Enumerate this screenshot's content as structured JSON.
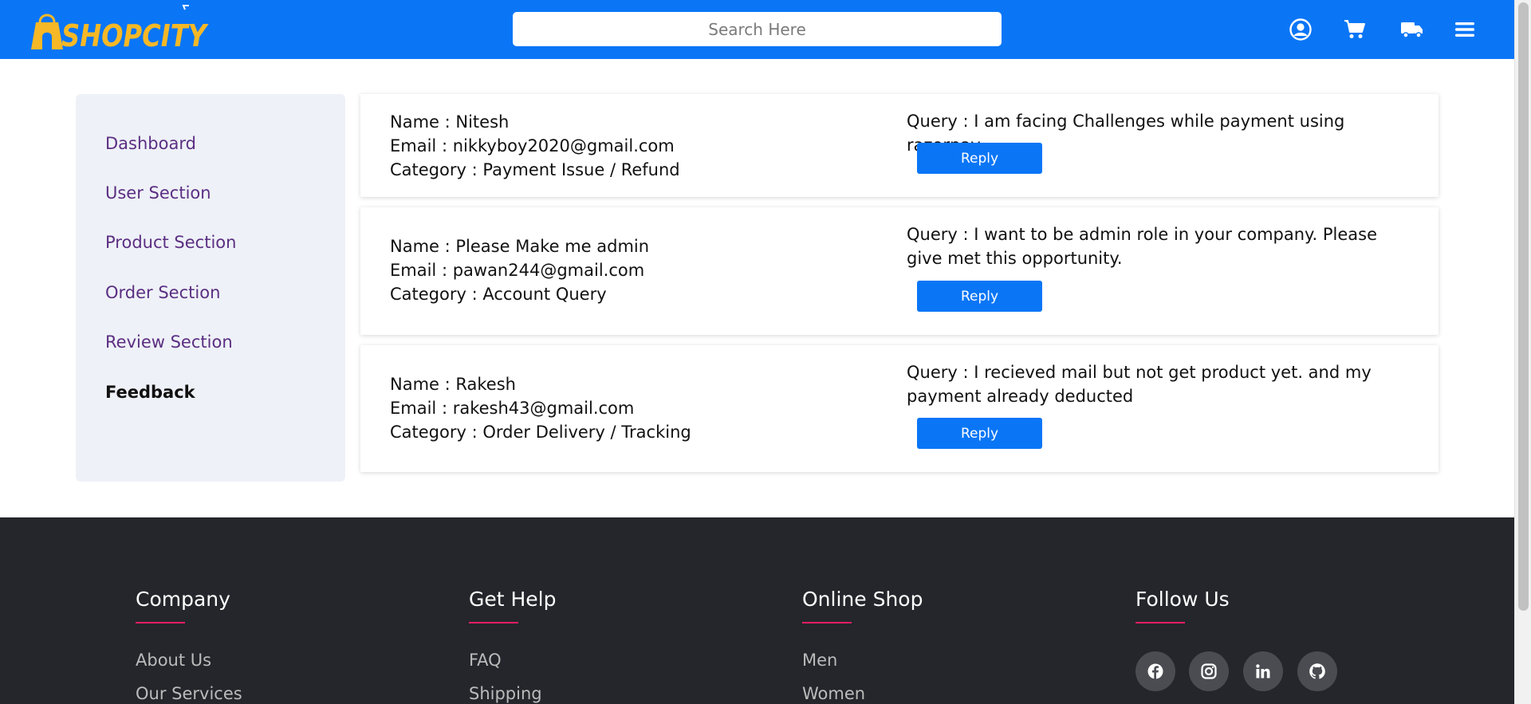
{
  "header": {
    "logo_text": "SHOPCITY",
    "search_placeholder": "Search Here",
    "icons": [
      "user-circle-icon",
      "cart-icon",
      "truck-icon",
      "menu-icon"
    ]
  },
  "sidebar": {
    "items": [
      {
        "label": "Dashboard"
      },
      {
        "label": "User Section"
      },
      {
        "label": "Product Section"
      },
      {
        "label": "Order Section"
      },
      {
        "label": "Review Section"
      },
      {
        "label": "Feedback",
        "active": true
      }
    ]
  },
  "feedback": [
    {
      "name": "Name : Nitesh",
      "email": "Email : nikkyboy2020@gmail.com",
      "category": "Category : Payment Issue / Refund",
      "query": "Query : I am facing Challenges while payment using razorpay.",
      "reply": "Reply"
    },
    {
      "name": "Name : Please Make me admin",
      "email": "Email : pawan244@gmail.com",
      "category": "Category : Account Query",
      "query": "Query : I want to be admin role in your company. Please give met this opportunity.",
      "reply": "Reply"
    },
    {
      "name": "Name : Rakesh",
      "email": "Email : rakesh43@gmail.com",
      "category": "Category : Order Delivery / Tracking",
      "query": "Query : I recieved mail but not get product yet. and my payment already deducted",
      "reply": "Reply"
    }
  ],
  "footer": {
    "columns": [
      {
        "title": "Company",
        "links": [
          "About Us",
          "Our Services"
        ]
      },
      {
        "title": "Get Help",
        "links": [
          "FAQ",
          "Shipping"
        ]
      },
      {
        "title": "Online Shop",
        "links": [
          "Men",
          "Women"
        ]
      },
      {
        "title": "Follow Us",
        "links": []
      }
    ],
    "social": [
      "facebook-icon",
      "instagram-icon",
      "linkedin-icon",
      "github-icon"
    ]
  },
  "colors": {
    "primary": "#0a76f6",
    "sidebar_bg": "#eef1f7",
    "sidebar_link": "#5b2e82",
    "footer_bg": "#24262b",
    "footer_accent": "#e91e63"
  }
}
